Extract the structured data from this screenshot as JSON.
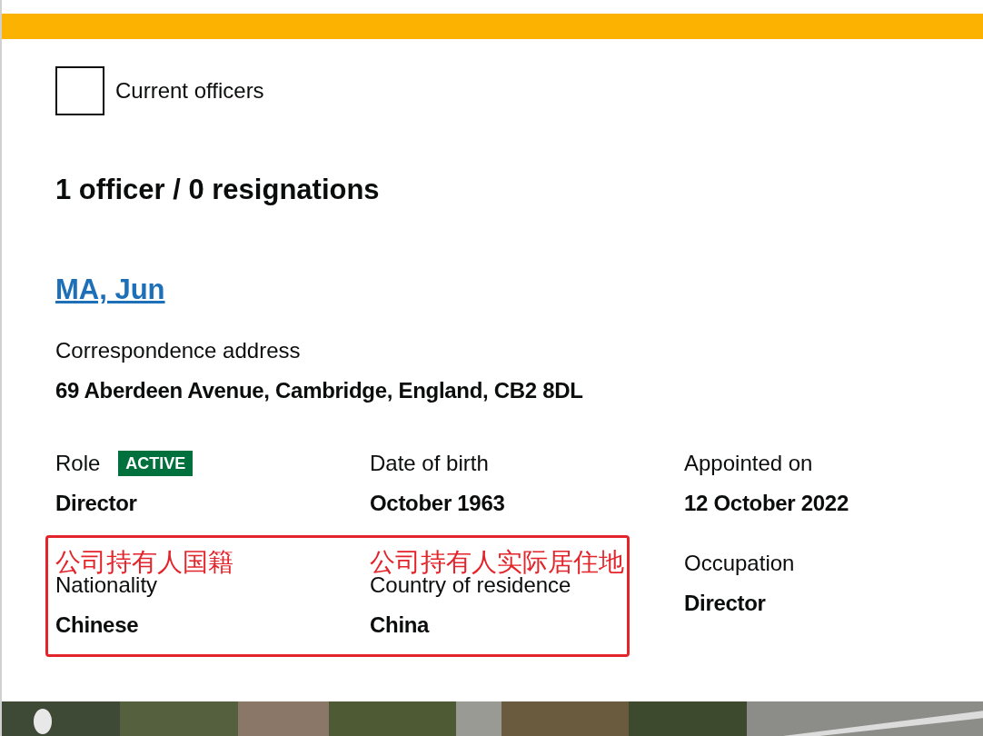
{
  "filter": {
    "label": "Current officers",
    "checked": false
  },
  "summary": "1 officer / 0 resignations",
  "officer": {
    "name": "MA, Jun",
    "address_label": "Correspondence address",
    "address": "69 Aberdeen Avenue, Cambridge, England, CB2 8DL",
    "rows": [
      [
        {
          "label": "Role",
          "tag": "ACTIVE",
          "value": "Director"
        },
        {
          "label": "Date of birth",
          "value": "October 1963"
        },
        {
          "label": "Appointed on",
          "value": "12 October 2022"
        }
      ],
      [
        {
          "label": "Nationality",
          "value": "Chinese",
          "annotation": "公司持有人国籍"
        },
        {
          "label": "Country of residence",
          "value": "China",
          "annotation": "公司持有人实际居住地"
        },
        {
          "label": "Occupation",
          "value": "Director"
        }
      ]
    ]
  }
}
